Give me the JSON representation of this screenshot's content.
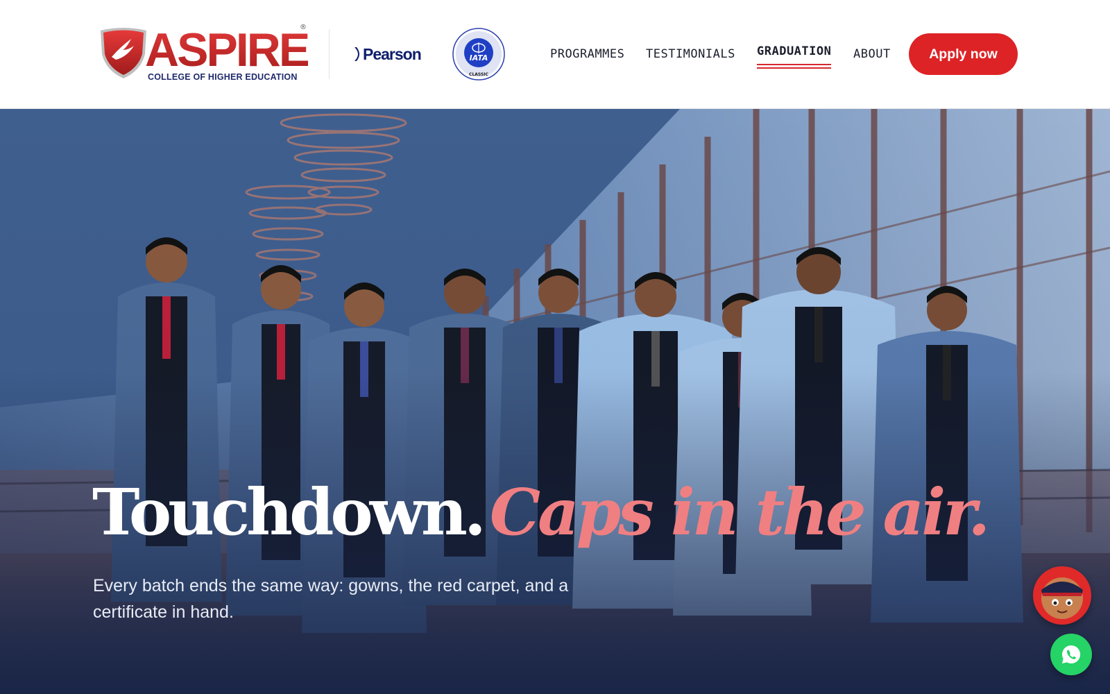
{
  "brand": {
    "logo_lettering": "ASPIRE",
    "logo_registered": "®",
    "logo_subtitle": "COLLEGE OF HIGHER EDUCATION",
    "pearson_lettering": "Pearson",
    "iata_lettering": "IATA",
    "iata_ring_top": "AUTHORIZED TRAINING CENTER",
    "iata_ring_bottom": "CLASSIC",
    "colors": {
      "brand_red": "#dd2326",
      "brand_navy": "#1f2a6b",
      "accent_pink": "#f07f82",
      "whatsapp_green": "#25d366"
    }
  },
  "nav": {
    "items": [
      {
        "label": "PROGRAMMES",
        "active": false
      },
      {
        "label": "TESTIMONIALS",
        "active": false
      },
      {
        "label": "GRADUATION",
        "active": true
      },
      {
        "label": "ABOUT",
        "active": false
      }
    ],
    "cta_label": "Apply now"
  },
  "hero": {
    "headline_main": "Touchdown.",
    "headline_accent": "Caps in the air.",
    "subcopy": "Every batch ends the same way: gowns, the red carpet, and a certificate in hand."
  },
  "floating": {
    "chat_icon": "mascot-chat-icon",
    "whatsapp_icon": "whatsapp-icon"
  }
}
